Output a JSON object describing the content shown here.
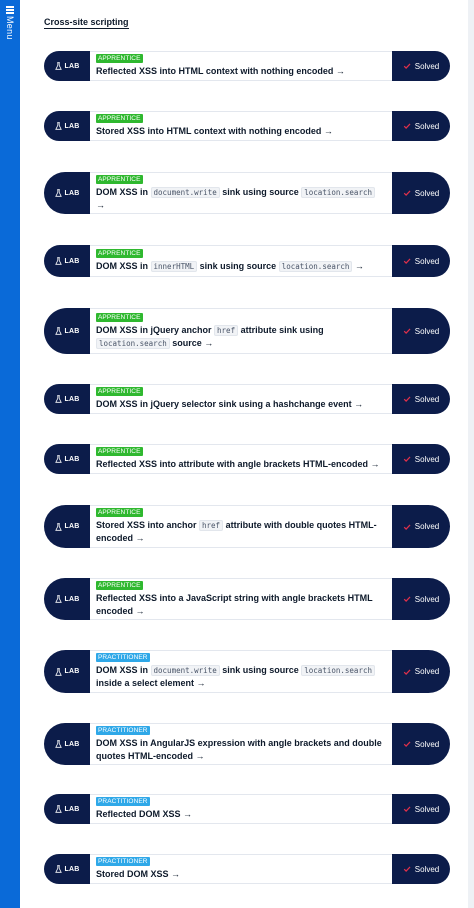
{
  "menu": {
    "label": "Menu"
  },
  "section": {
    "title": "Cross-site scripting"
  },
  "badge_label": "LAB",
  "status_label": "Solved",
  "colors": {
    "navy": "#0c1c4a",
    "apprentice": "#2fb82f",
    "practitioner": "#2fa8e8",
    "menu_blue": "#0a6ad8",
    "check_red": "#e0304a"
  },
  "labs": [
    {
      "level": "APPRENTICE",
      "parts": [
        "Reflected XSS into HTML context with nothing encoded"
      ]
    },
    {
      "level": "APPRENTICE",
      "parts": [
        "Stored XSS into HTML context with nothing encoded"
      ]
    },
    {
      "level": "APPRENTICE",
      "parts": [
        "DOM XSS in ",
        {
          "code": "document.write"
        },
        " sink using source ",
        {
          "code": "location.search"
        }
      ]
    },
    {
      "level": "APPRENTICE",
      "parts": [
        "DOM XSS in ",
        {
          "code": "innerHTML"
        },
        " sink using source ",
        {
          "code": "location.search"
        }
      ]
    },
    {
      "level": "APPRENTICE",
      "parts": [
        "DOM XSS in jQuery anchor ",
        {
          "code": "href"
        },
        " attribute sink using ",
        {
          "code": "location.search"
        },
        " source"
      ]
    },
    {
      "level": "APPRENTICE",
      "parts": [
        "DOM XSS in jQuery selector sink using a hashchange event"
      ]
    },
    {
      "level": "APPRENTICE",
      "parts": [
        "Reflected XSS into attribute with angle brackets HTML-encoded"
      ]
    },
    {
      "level": "APPRENTICE",
      "parts": [
        "Stored XSS into anchor ",
        {
          "code": "href"
        },
        " attribute with double quotes HTML-encoded"
      ]
    },
    {
      "level": "APPRENTICE",
      "parts": [
        "Reflected XSS into a JavaScript string with angle brackets HTML encoded"
      ]
    },
    {
      "level": "PRACTITIONER",
      "parts": [
        "DOM XSS in ",
        {
          "code": "document.write"
        },
        " sink using source ",
        {
          "code": "location.search"
        },
        " inside a select element"
      ]
    },
    {
      "level": "PRACTITIONER",
      "parts": [
        "DOM XSS in AngularJS expression with angle brackets and double quotes HTML-encoded"
      ]
    },
    {
      "level": "PRACTITIONER",
      "parts": [
        "Reflected DOM XSS"
      ]
    },
    {
      "level": "PRACTITIONER",
      "parts": [
        "Stored DOM XSS"
      ]
    }
  ]
}
